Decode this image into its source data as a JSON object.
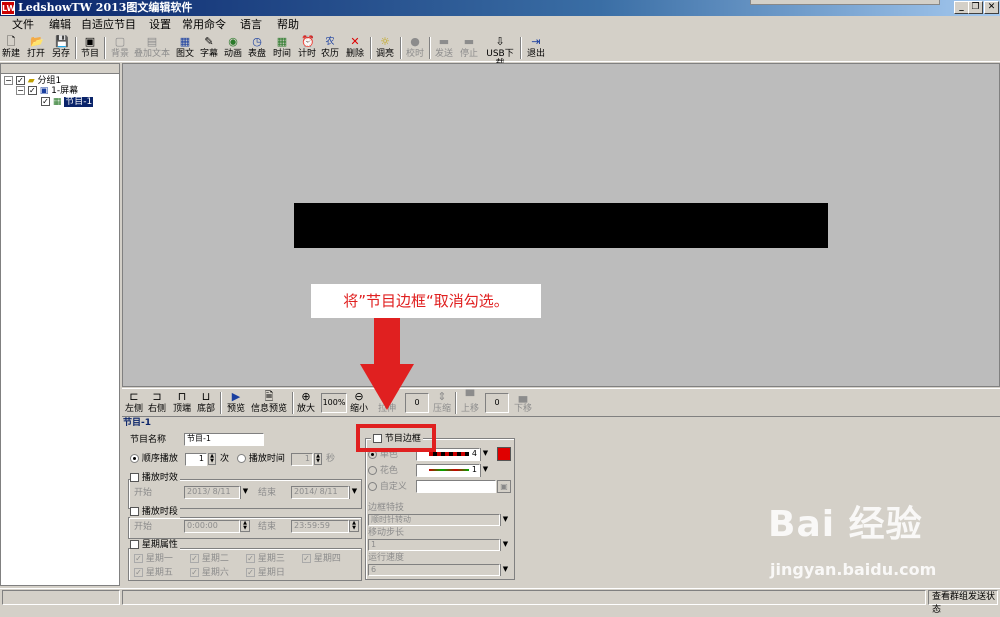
{
  "window": {
    "title": "LedshowTW  2013图文编辑软件",
    "app_icon": "LW"
  },
  "menu": [
    "文件",
    "编辑",
    "自适应节目",
    "设置",
    "常用命令",
    "语言",
    "帮助"
  ],
  "toolbar": [
    {
      "label": "新建",
      "icon": "new-icon",
      "glyph": "🗋",
      "enabled": true
    },
    {
      "label": "打开",
      "icon": "open-icon",
      "glyph": "📂",
      "enabled": true
    },
    {
      "label": "另存",
      "icon": "save-icon",
      "glyph": "💾",
      "enabled": true
    },
    {
      "label": "节目",
      "icon": "program-icon",
      "glyph": "▣",
      "enabled": true
    },
    {
      "label": "背景",
      "icon": "background-icon",
      "glyph": "▢",
      "enabled": false
    },
    {
      "label": "叠加文本",
      "icon": "overlay-text-icon",
      "glyph": "▤",
      "enabled": false
    },
    {
      "label": "图文",
      "icon": "image-text-icon",
      "glyph": "▦",
      "enabled": true
    },
    {
      "label": "字幕",
      "icon": "subtitle-icon",
      "glyph": "✎",
      "enabled": true
    },
    {
      "label": "动画",
      "icon": "animation-icon",
      "glyph": "◉",
      "enabled": true
    },
    {
      "label": "表盘",
      "icon": "clock-icon",
      "glyph": "◷",
      "enabled": true
    },
    {
      "label": "时间",
      "icon": "time-icon",
      "glyph": "▦",
      "enabled": true
    },
    {
      "label": "计时",
      "icon": "timer-icon",
      "glyph": "⏰",
      "enabled": true
    },
    {
      "label": "农历",
      "icon": "lunar-icon",
      "glyph": "农",
      "enabled": true
    },
    {
      "label": "删除",
      "icon": "delete-icon",
      "glyph": "✕",
      "enabled": true
    },
    {
      "label": "调亮",
      "icon": "brightness-icon",
      "glyph": "☼",
      "enabled": true
    },
    {
      "label": "校时",
      "icon": "sync-time-icon",
      "glyph": "●",
      "enabled": false
    },
    {
      "label": "发送",
      "icon": "send-icon",
      "glyph": "▬",
      "enabled": false
    },
    {
      "label": "停止",
      "icon": "stop-icon",
      "glyph": "▬",
      "enabled": false
    },
    {
      "label": "USB下载",
      "icon": "usb-icon",
      "glyph": "⇩",
      "enabled": true
    },
    {
      "label": "退出",
      "icon": "exit-icon",
      "glyph": "⇥",
      "enabled": true
    }
  ],
  "tree": {
    "group": "分组1",
    "screen": "1-屏幕",
    "program": "节目-1"
  },
  "annotation": "将”节目边框“取消勾选。",
  "toolbar2": [
    {
      "label": "左侧",
      "icon": "align-left-icon",
      "enabled": true
    },
    {
      "label": "右侧",
      "icon": "align-right-icon",
      "enabled": true
    },
    {
      "label": "顶端",
      "icon": "align-top-icon",
      "enabled": true
    },
    {
      "label": "底部",
      "icon": "align-bottom-icon",
      "enabled": true
    },
    {
      "label": "预览",
      "icon": "preview-icon",
      "enabled": true
    },
    {
      "label": "信息预览",
      "icon": "info-preview-icon",
      "enabled": true
    },
    {
      "label": "放大",
      "icon": "zoom-in-icon",
      "enabled": true
    },
    {
      "label": "缩小",
      "icon": "zoom-out-icon",
      "enabled": true
    },
    {
      "label": "拉伸",
      "icon": "stretch-icon",
      "enabled": false
    },
    {
      "label": "压缩",
      "icon": "compress-icon",
      "enabled": false
    },
    {
      "label": "上移",
      "icon": "move-up-icon",
      "enabled": false
    },
    {
      "label": "下移",
      "icon": "move-down-icon",
      "enabled": false
    }
  ],
  "zoom_value": "100%",
  "stretch_value": "0",
  "move_value": "0",
  "props": {
    "section_title": "节目-1",
    "name_label": "节目名称",
    "name_value": "节目-1",
    "play_mode_seq": "顺序播放",
    "play_times": "1",
    "times_unit": "次",
    "play_mode_time": "播放时间",
    "play_seconds": "1",
    "seconds_unit": "秒",
    "validity_label": "播放时效",
    "start_label": "开始",
    "end_label": "结束",
    "start_date": "2013/ 8/11",
    "end_date": "2014/ 8/11",
    "period_label": "播放时段",
    "start_time": "0:00:00",
    "end_time": "23:59:59",
    "week_label": "星期属性",
    "weekdays": [
      "星期一",
      "星期二",
      "星期三",
      "星期四",
      "星期五",
      "星期六",
      "星期日"
    ],
    "border_label": "节目边框",
    "border_options": [
      "单色",
      "花色",
      "自定义"
    ],
    "pure_value": "4",
    "fancy_value": "1",
    "effect_label": "边框特技",
    "effect_value": "顺时针转动",
    "step_label": "移动步长",
    "step_value": "1",
    "speed_label": "运行速度",
    "speed_value": "6"
  },
  "status": {
    "right_text": "查看群组发送状态"
  },
  "watermark": {
    "logo": "Bai 经验",
    "url": "jingyan.baidu.com"
  },
  "colors": {
    "title_bar": "#0a246a",
    "annotation_red": "#e02020",
    "preview_bg": "#bcbcbc"
  }
}
